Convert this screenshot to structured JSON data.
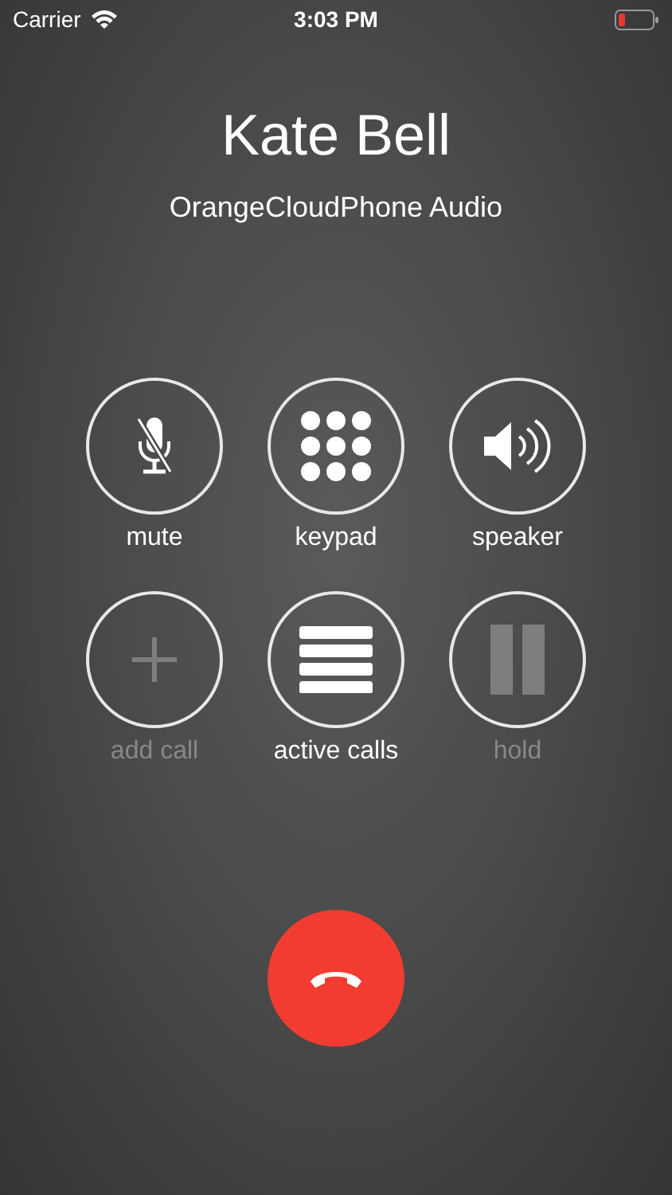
{
  "status_bar": {
    "carrier": "Carrier",
    "time": "3:03 PM"
  },
  "caller": {
    "name": "Kate Bell",
    "subtitle": "OrangeCloudPhone Audio"
  },
  "controls": [
    {
      "kind": "mute",
      "label": "mute",
      "disabled": false
    },
    {
      "kind": "keypad",
      "label": "keypad",
      "disabled": false
    },
    {
      "kind": "speaker",
      "label": "speaker",
      "disabled": false
    },
    {
      "kind": "add",
      "label": "add call",
      "disabled": true
    },
    {
      "kind": "calls",
      "label": "active calls",
      "disabled": false
    },
    {
      "kind": "hold",
      "label": "hold",
      "disabled": true
    }
  ]
}
